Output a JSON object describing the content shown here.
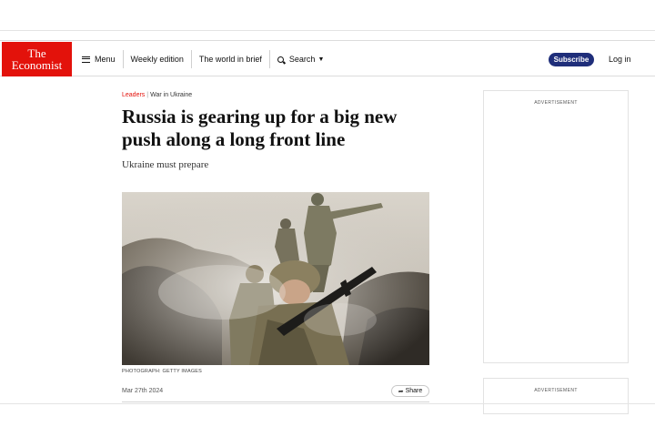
{
  "header": {
    "logo_line1": "The",
    "logo_line2": "Economist",
    "nav": {
      "menu": "Menu",
      "weekly_edition": "Weekly edition",
      "world_in_brief": "The world in brief",
      "search": "Search"
    },
    "subscribe": "Subscribe",
    "login": "Log in"
  },
  "article": {
    "section": "Leaders",
    "subsection": "War in Ukraine",
    "headline": "Russia is gearing up for a big new push along a long front line",
    "standfirst": "Ukraine must prepare",
    "photo_credit": "PHOTOGRAPH: GETTY IMAGES",
    "date": "Mar 27th 2024",
    "share": "Share"
  },
  "ads": {
    "label1": "ADVERTISEMENT",
    "label2": "ADVERTISEMENT"
  },
  "colors": {
    "brand_red": "#e3120b",
    "subscribe_blue": "#1f2e7a"
  }
}
